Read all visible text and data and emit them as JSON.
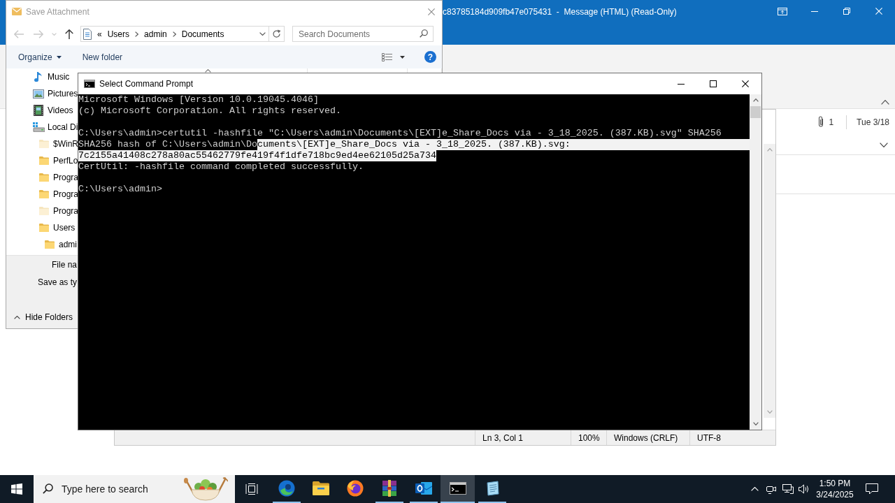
{
  "outlook": {
    "title": "c83785184d909fb47e075431  -  Message (HTML) (Read-Only)",
    "attachment_count": "1",
    "date": "Tue 3/18"
  },
  "save_dialog": {
    "title": "Save Attachment",
    "path_overflow": "«",
    "path": [
      "Users",
      "admin",
      "Documents"
    ],
    "search": {
      "placeholder": "Search Documents"
    },
    "toolbar": [
      {
        "label": "Organize",
        "kind": "menu"
      },
      {
        "label": "New folder",
        "kind": "button"
      }
    ],
    "help": "?",
    "tree": [
      {
        "label": "Music",
        "kind": "music",
        "hidden": false
      },
      {
        "label": "Pictures",
        "kind": "pictures",
        "hidden": false
      },
      {
        "label": "Videos",
        "kind": "videos",
        "hidden": false
      },
      {
        "label": "Local Di",
        "kind": "drive",
        "hidden": false,
        "children": [
          {
            "label": "$WinR",
            "kind": "folder",
            "hidden": true
          },
          {
            "label": "PerfLo",
            "kind": "folder",
            "hidden": false
          },
          {
            "label": "Progra",
            "kind": "folder",
            "hidden": false
          },
          {
            "label": "Progra",
            "kind": "folder",
            "hidden": false
          },
          {
            "label": "Progra",
            "kind": "folder",
            "hidden": true
          },
          {
            "label": "Users",
            "kind": "folder",
            "hidden": false,
            "children": [
              {
                "label": "admi",
                "kind": "folder",
                "hidden": false
              }
            ]
          }
        ]
      }
    ],
    "form_labels": [
      "File na",
      "Save as ty"
    ],
    "hide_folders": "Hide Folders"
  },
  "notepad": {
    "status": [
      "Ln 3, Col 1",
      "100%",
      "Windows (CRLF)",
      "UTF-8"
    ]
  },
  "console": {
    "title": "Select Command Prompt",
    "blocks": [
      {
        "lines": [
          {
            "segments": [
              {
                "text": "Microsoft Windows [Version 10.0.19045.4046]",
                "selected": false
              }
            ]
          },
          {
            "segments": [
              {
                "text": "(c) Microsoft Corporation. All rights reserved.",
                "selected": false
              }
            ]
          }
        ]
      },
      {
        "lines": [
          {
            "segments": [
              {
                "text": "C:\\Users\\admin>certutil -hashfile \"C:\\Users\\admin\\Documents\\[EXT]e_Share_Docs via - 3_18_2025. (387.KB).svg\" SHA256",
                "selected": false
              }
            ]
          },
          {
            "segments": [
              {
                "text": "SHA256 hash of C:\\Users\\admin\\Do",
                "selected": false
              },
              {
                "text": "cuments\\[EXT]e_Share_Docs via - 3_18_2025. (387.KB).svg:",
                "selected": true
              }
            ]
          },
          {
            "segments": [
              {
                "text": "7c2155a41408c278a80ac55462779fe419f4f1dfe718bc9ed4ee62105d25a734",
                "selected": true
              }
            ]
          },
          {
            "segments": [
              {
                "text": "CertUtil: -hashfile command completed successfully.",
                "selected": false
              }
            ]
          }
        ]
      },
      {
        "lines": [
          {
            "segments": [
              {
                "text": "C:\\Users\\admin>",
                "selected": false
              }
            ]
          }
        ]
      }
    ]
  },
  "taskbar": {
    "search": {
      "placeholder": "Type here to search"
    },
    "apps": [
      {
        "kind": "swirl",
        "running": true,
        "selected": false
      },
      {
        "kind": "folder",
        "running": false,
        "selected": false
      },
      {
        "kind": "flame_globe",
        "running": false,
        "selected": false
      },
      {
        "kind": "books",
        "running": true,
        "selected": false
      },
      {
        "kind": "mail",
        "running": true,
        "selected": false
      },
      {
        "kind": "terminal",
        "running": true,
        "selected": true
      },
      {
        "kind": "notepad",
        "running": true,
        "selected": false
      }
    ],
    "time": "1:50 PM",
    "date": "3/24/2025"
  }
}
